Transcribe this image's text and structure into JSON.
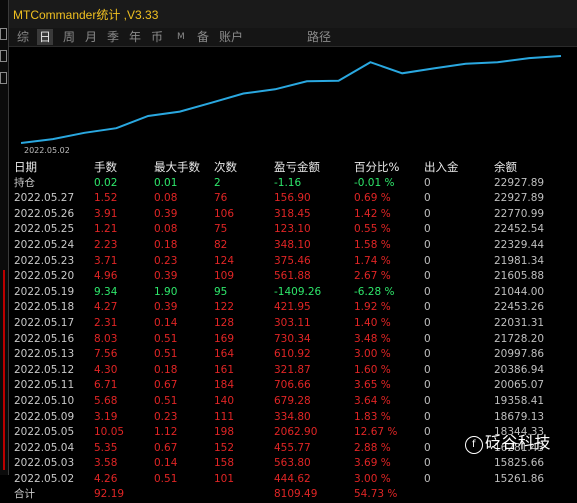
{
  "window": {
    "title": "MTCommander统计 ,V3.33"
  },
  "tabs": [
    {
      "label": "综",
      "active": false,
      "small": false
    },
    {
      "label": "日",
      "active": true,
      "small": false
    },
    {
      "label": "周",
      "active": false,
      "small": false
    },
    {
      "label": "月",
      "active": false,
      "small": false
    },
    {
      "label": "季",
      "active": false,
      "small": false
    },
    {
      "label": "年",
      "active": false,
      "small": false
    },
    {
      "label": "币",
      "active": false,
      "small": false
    },
    {
      "label": "M",
      "active": false,
      "small": true
    },
    {
      "label": "备",
      "active": false,
      "small": false
    },
    {
      "label": "账户",
      "active": false,
      "small": false
    },
    {
      "label": "路径",
      "active": false,
      "small": false
    }
  ],
  "chart_data": {
    "type": "line",
    "x_start_label": "2022.05.02",
    "color": "#2aa8e0",
    "series": [
      {
        "values": [
          16281.43,
          16581.48,
          17060.0,
          17410.0,
          18344.33,
          18679.13,
          19358.41,
          20065.07,
          20386.94,
          20997.86,
          21044.0,
          22453.26,
          21605.88,
          21981.34,
          22329.44,
          22452.54,
          22770.99,
          22927.89
        ]
      }
    ]
  },
  "columns": [
    "日期",
    "手数",
    "最大手数",
    "次数",
    "盈亏金额",
    "百分比%",
    "出入金",
    "余额"
  ],
  "rows": [
    {
      "date": "持仓",
      "lots": "0.02",
      "max": "0.01",
      "count": "2",
      "pnl": "-1.16",
      "pct": "-0.01 %",
      "flow": "0",
      "bal": "22927.89",
      "color": "green"
    },
    {
      "date": "2022.05.27",
      "lots": "1.52",
      "max": "0.08",
      "count": "76",
      "pnl": "156.90",
      "pct": "0.69 %",
      "flow": "0",
      "bal": "22927.89",
      "color": "red"
    },
    {
      "date": "2022.05.26",
      "lots": "3.91",
      "max": "0.39",
      "count": "106",
      "pnl": "318.45",
      "pct": "1.42 %",
      "flow": "0",
      "bal": "22770.99",
      "color": "red"
    },
    {
      "date": "2022.05.25",
      "lots": "1.21",
      "max": "0.08",
      "count": "75",
      "pnl": "123.10",
      "pct": "0.55 %",
      "flow": "0",
      "bal": "22452.54",
      "color": "red"
    },
    {
      "date": "2022.05.24",
      "lots": "2.23",
      "max": "0.18",
      "count": "82",
      "pnl": "348.10",
      "pct": "1.58 %",
      "flow": "0",
      "bal": "22329.44",
      "color": "red"
    },
    {
      "date": "2022.05.23",
      "lots": "3.71",
      "max": "0.23",
      "count": "124",
      "pnl": "375.46",
      "pct": "1.74 %",
      "flow": "0",
      "bal": "21981.34",
      "color": "red"
    },
    {
      "date": "2022.05.20",
      "lots": "4.96",
      "max": "0.39",
      "count": "109",
      "pnl": "561.88",
      "pct": "2.67 %",
      "flow": "0",
      "bal": "21605.88",
      "color": "red"
    },
    {
      "date": "2022.05.19",
      "lots": "9.34",
      "max": "1.90",
      "count": "95",
      "pnl": "-1409.26",
      "pct": "-6.28 %",
      "flow": "0",
      "bal": "21044.00",
      "color": "green"
    },
    {
      "date": "2022.05.18",
      "lots": "4.27",
      "max": "0.39",
      "count": "122",
      "pnl": "421.95",
      "pct": "1.92 %",
      "flow": "0",
      "bal": "22453.26",
      "color": "red"
    },
    {
      "date": "2022.05.17",
      "lots": "2.31",
      "max": "0.14",
      "count": "128",
      "pnl": "303.11",
      "pct": "1.40 %",
      "flow": "0",
      "bal": "22031.31",
      "color": "red"
    },
    {
      "date": "2022.05.16",
      "lots": "8.03",
      "max": "0.51",
      "count": "169",
      "pnl": "730.34",
      "pct": "3.48 %",
      "flow": "0",
      "bal": "21728.20",
      "color": "red"
    },
    {
      "date": "2022.05.13",
      "lots": "7.56",
      "max": "0.51",
      "count": "164",
      "pnl": "610.92",
      "pct": "3.00 %",
      "flow": "0",
      "bal": "20997.86",
      "color": "red"
    },
    {
      "date": "2022.05.12",
      "lots": "4.30",
      "max": "0.18",
      "count": "161",
      "pnl": "321.87",
      "pct": "1.60 %",
      "flow": "0",
      "bal": "20386.94",
      "color": "red"
    },
    {
      "date": "2022.05.11",
      "lots": "6.71",
      "max": "0.67",
      "count": "184",
      "pnl": "706.66",
      "pct": "3.65 %",
      "flow": "0",
      "bal": "20065.07",
      "color": "red"
    },
    {
      "date": "2022.05.10",
      "lots": "5.68",
      "max": "0.51",
      "count": "140",
      "pnl": "679.28",
      "pct": "3.64 %",
      "flow": "0",
      "bal": "19358.41",
      "color": "red"
    },
    {
      "date": "2022.05.09",
      "lots": "3.19",
      "max": "0.23",
      "count": "111",
      "pnl": "334.80",
      "pct": "1.83 %",
      "flow": "0",
      "bal": "18679.13",
      "color": "red"
    },
    {
      "date": "2022.05.05",
      "lots": "10.05",
      "max": "1.12",
      "count": "198",
      "pnl": "2062.90",
      "pct": "12.67 %",
      "flow": "0",
      "bal": "18344.33",
      "color": "red"
    },
    {
      "date": "2022.05.04",
      "lots": "5.35",
      "max": "0.67",
      "count": "152",
      "pnl": "455.77",
      "pct": "2.88 %",
      "flow": "0",
      "bal": "16281.43",
      "color": "red"
    },
    {
      "date": "2022.05.03",
      "lots": "3.58",
      "max": "0.14",
      "count": "158",
      "pnl": "563.80",
      "pct": "3.69 %",
      "flow": "0",
      "bal": "15825.66",
      "color": "red"
    },
    {
      "date": "2022.05.02",
      "lots": "4.26",
      "max": "0.51",
      "count": "101",
      "pnl": "444.62",
      "pct": "3.00 %",
      "flow": "0",
      "bal": "15261.86",
      "color": "red"
    },
    {
      "date": "合计",
      "lots": "92.19",
      "max": "",
      "count": "",
      "pnl": "8109.49",
      "pct": "54.73 %",
      "flow": "",
      "bal": "",
      "color": "red"
    }
  ],
  "watermark": {
    "text": "砭谷科技"
  }
}
